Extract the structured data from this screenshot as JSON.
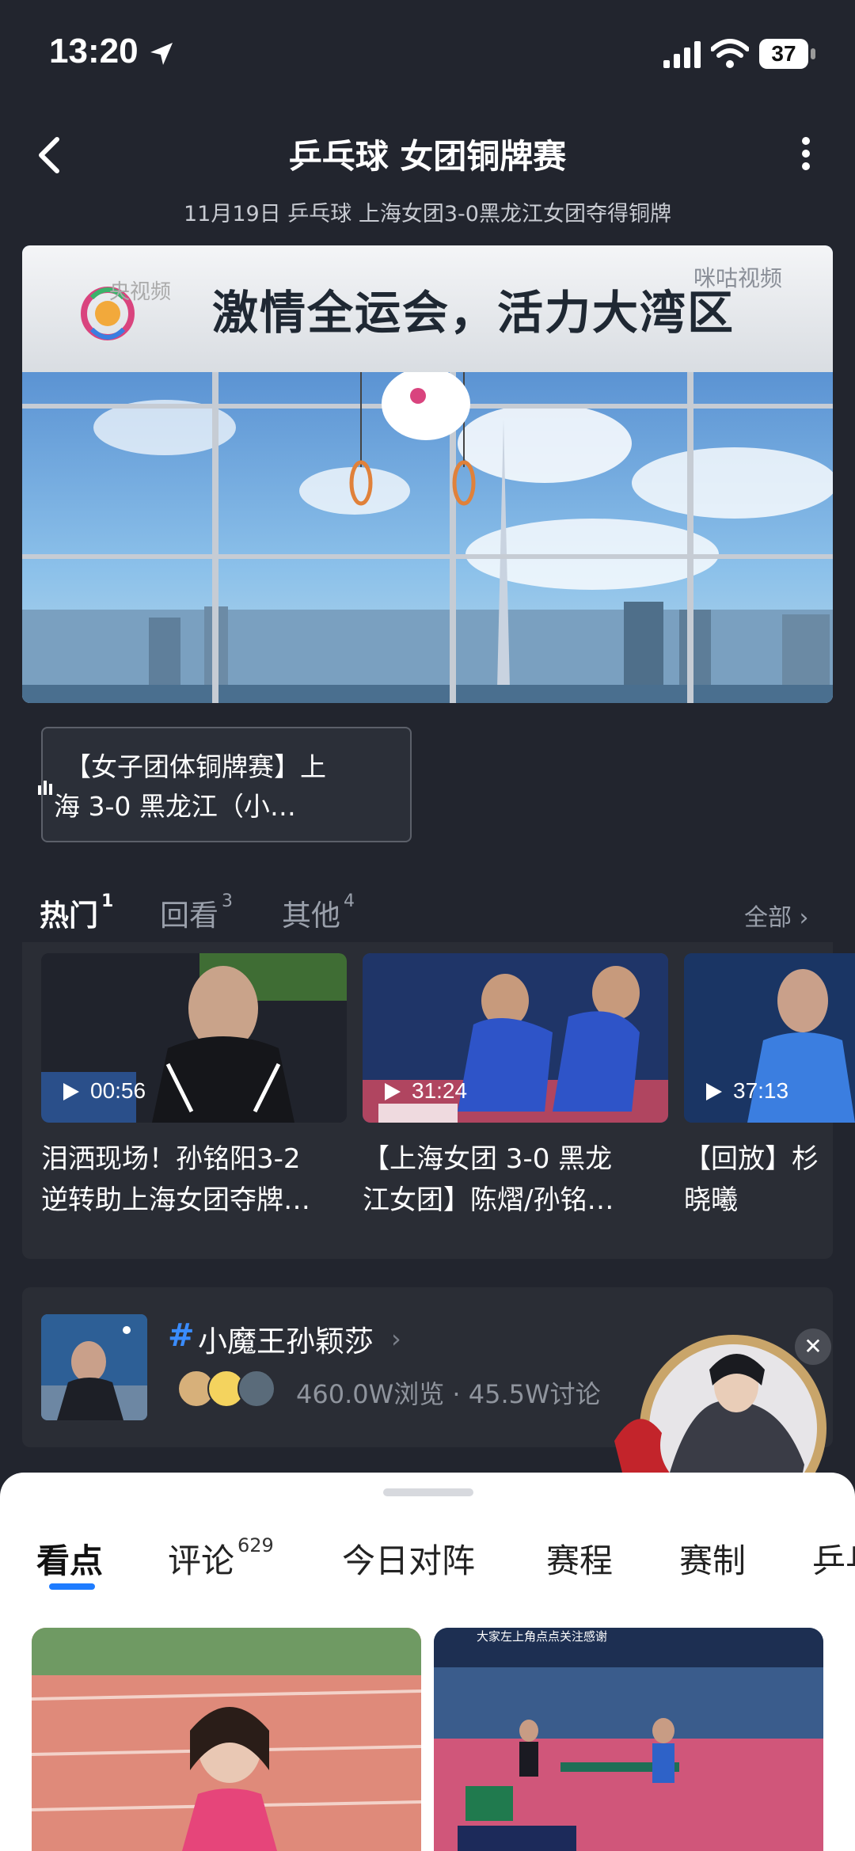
{
  "status_bar": {
    "time": "13:20",
    "battery": "37"
  },
  "header": {
    "title": "乒乓球 女团铜牌赛",
    "subtitle": "11月19日 乒乓球 上海女团3-0黑龙江女团夺得铜牌"
  },
  "player": {
    "slogan": "激情全运会，活力大湾区",
    "broadcaster": "央视频",
    "partner": "咪咕视频"
  },
  "episode": {
    "line1": "【女子团体铜牌赛】上",
    "line2": "海 3-0 黑龙江（小…"
  },
  "section_tabs": {
    "hot": "热门",
    "hot_count": "1",
    "replay": "回看",
    "replay_count": "3",
    "other": "其他",
    "other_count": "4",
    "all": "全部 ›"
  },
  "videos": [
    {
      "duration": "00:56",
      "title1": "泪洒现场！孙铭阳3-2",
      "title2": "逆转助上海女团夺牌…"
    },
    {
      "duration": "31:24",
      "title1": "【上海女团 3-0 黑龙",
      "title2": "江女团】陈熠/孙铭…"
    },
    {
      "duration": "37:13",
      "title1": "【回放】杉",
      "title2": "晓曦"
    }
  ],
  "topic": {
    "hash": "#",
    "title": "小魔王孙颖莎",
    "chevron": "›",
    "stats": "460.0W浏览 · 45.5W讨论"
  },
  "promo": {
    "close": "✕"
  },
  "sheet_tabs": {
    "highlights": "看点",
    "comments": "评论",
    "comments_count": "629",
    "today_matchups": "今日对阵",
    "schedule": "赛程",
    "format": "赛制",
    "more": "乒乓"
  },
  "feed": {
    "caption": "大家左上角点点关注感谢"
  },
  "colors": {
    "accent": "#1e7cff",
    "background": "#22252e",
    "panel": "#2a2d35"
  }
}
